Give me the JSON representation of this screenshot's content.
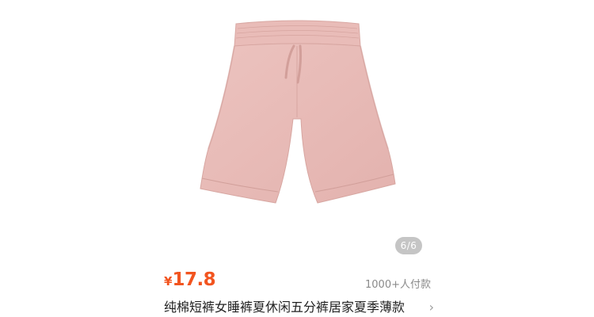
{
  "product": {
    "image_icon": "pink-cotton-shorts-image",
    "page_indicator": "6/6",
    "price_currency": "¥",
    "price_value": "17.8",
    "sales": "1000+人付款",
    "title": "纯棉短裤女睡裤夏休闲五分裤居家夏季薄款",
    "chevron_icon": "chevron-right-icon",
    "chevron_glyph": "›"
  },
  "colors": {
    "price": "#f2541f",
    "shorts_fill": "#e7b9b5",
    "sales_text": "#8a8a8a",
    "title_text": "#222222"
  }
}
